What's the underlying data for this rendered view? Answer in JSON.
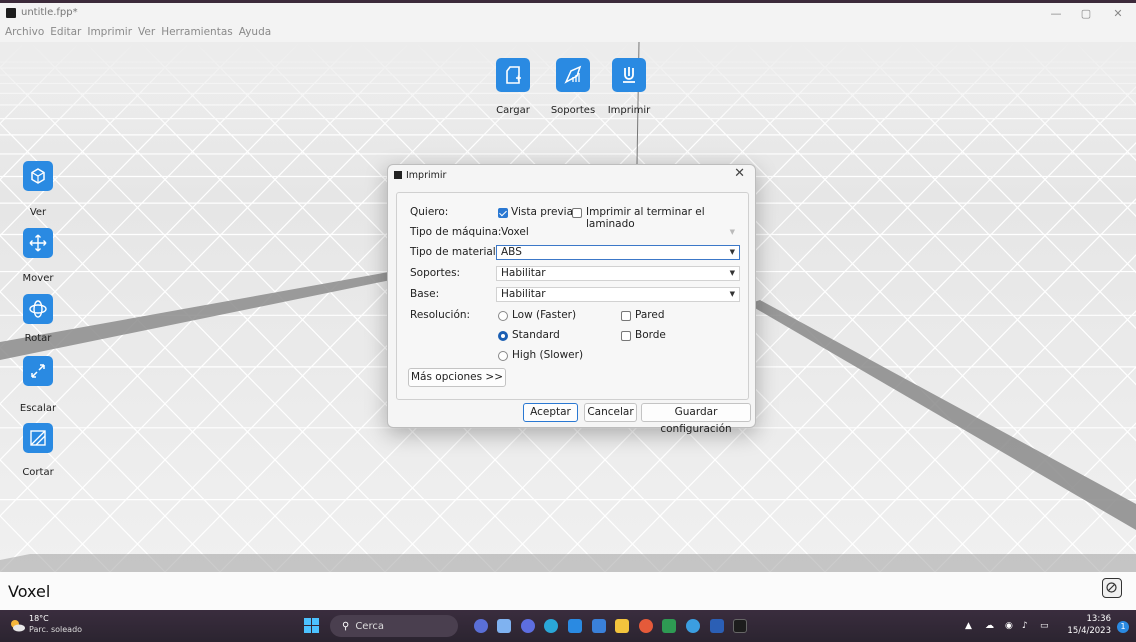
{
  "window": {
    "title": "untitle.fpp*",
    "minimize": "—",
    "maximize": "▢",
    "close": "✕"
  },
  "menu": [
    "Archivo",
    "Editar",
    "Imprimir",
    "Ver",
    "Herramientas",
    "Ayuda"
  ],
  "top_tools": [
    {
      "label": "Cargar",
      "icon": "load-icon"
    },
    {
      "label": "Soportes",
      "icon": "supports-icon"
    },
    {
      "label": "Imprimir",
      "icon": "print-icon"
    }
  ],
  "side_tools": [
    {
      "label": "Ver",
      "icon": "view-cube-icon"
    },
    {
      "label": "Mover",
      "icon": "move-icon"
    },
    {
      "label": "Rotar",
      "icon": "rotate-icon"
    },
    {
      "label": "Escalar",
      "icon": "scale-icon"
    },
    {
      "label": "Cortar",
      "icon": "cut-icon"
    }
  ],
  "dialog": {
    "title": "Imprimir",
    "quiero_label": "Quiero:",
    "vista_previa": {
      "label": "Vista previa",
      "checked": true
    },
    "imprimir_al_terminar": {
      "label": "Imprimir al terminar el laminado",
      "checked": false
    },
    "tipo_maquina": {
      "label": "Tipo de máquina:",
      "value": "Voxel"
    },
    "tipo_material": {
      "label": "Tipo de material:",
      "value": "ABS"
    },
    "soportes": {
      "label": "Soportes:",
      "value": "Habilitar"
    },
    "base": {
      "label": "Base:",
      "value": "Habilitar"
    },
    "resolucion": {
      "label": "Resolución:",
      "options": [
        "Low (Faster)",
        "Standard",
        "High (Slower)"
      ],
      "selected": "Standard"
    },
    "pared": {
      "label": "Pared",
      "checked": false
    },
    "borde": {
      "label": "Borde",
      "checked": false
    },
    "mas_opciones": "Más opciones >>",
    "aceptar": "Aceptar",
    "cancelar": "Cancelar",
    "guardar": "Guardar configuración"
  },
  "status": {
    "text": "Voxel"
  },
  "taskbar": {
    "weather_temp": "18°C",
    "weather_desc": "Parc. soleado",
    "search": "Cerca",
    "time": "13:36",
    "date": "15/4/2023",
    "notifications": "1"
  },
  "colors": {
    "accent": "#2a8ae2",
    "taskbar": "#2e2633"
  }
}
